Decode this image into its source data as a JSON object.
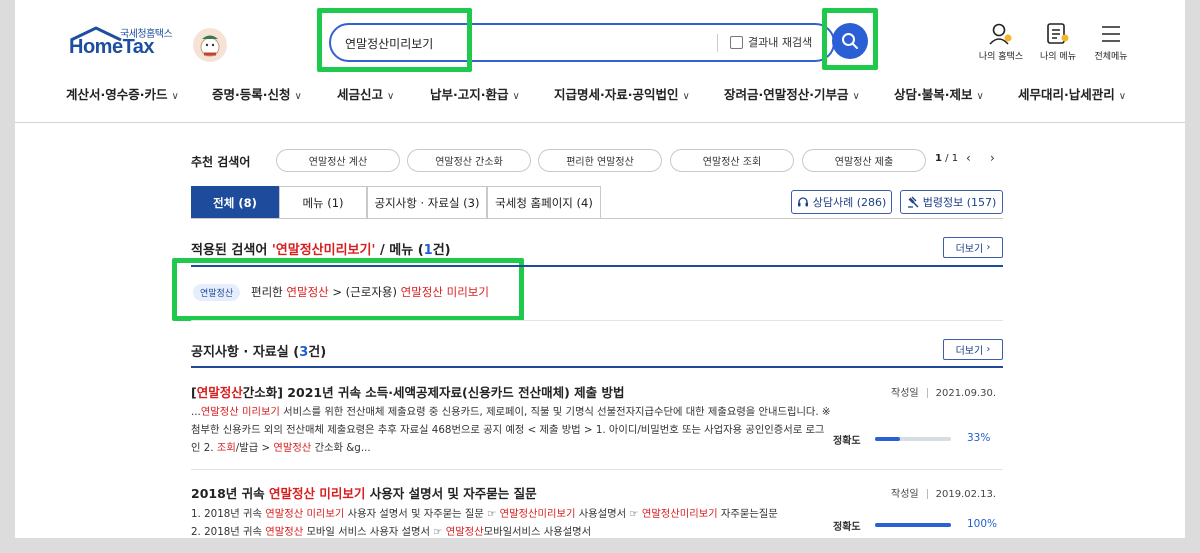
{
  "header": {
    "logo_small": "국세청홈택스",
    "logo_big": "HomeTax",
    "search_value": "연말정산미리보기",
    "refine_label": "결과내 재검색",
    "icons": [
      {
        "name": "person-icon",
        "label": "나의 홈택스"
      },
      {
        "name": "my-menu-icon",
        "label": "나의 메뉴"
      },
      {
        "name": "hamburger-icon",
        "label": "전체메뉴"
      }
    ],
    "accent": "#2a5fd6",
    "highlight": "#1ec94b"
  },
  "gnb": [
    "계산서·영수증·카드",
    "증명·등록·신청",
    "세금신고",
    "납부·고지·환급",
    "지급명세·자료·공익법인",
    "장려금·연말정산·기부금",
    "상담·불복·제보",
    "세무대리·납세관리"
  ],
  "recommended": {
    "label": "추천 검색어",
    "chips": [
      "연말정산 계산",
      "연말정산 간소화",
      "편리한 연말정산",
      "연말정산 조회",
      "연말정산 제출"
    ],
    "page_current": "1",
    "page_total": "/ 1"
  },
  "tabs": [
    {
      "label": "전체 (8)",
      "active": true
    },
    {
      "label": "메뉴 (1)",
      "active": false
    },
    {
      "label": "공지사항 · 자료실 (3)",
      "active": false
    },
    {
      "label": "국세청 홈페이지 (4)",
      "active": false
    }
  ],
  "side_buttons": [
    "상담사례 (286)",
    "법령정보 (157)"
  ],
  "menu_section": {
    "title_prefix": "적용된 검색어 ",
    "title_term": "'연말정산미리보기'",
    "title_mid": " / 메뉴 (",
    "title_count": "1",
    "title_suffix": "건)",
    "more": "더보기",
    "tag": "연말정산",
    "path_1": "편리한 ",
    "path_2": "연말정산",
    "path_3": " > (근로자용) ",
    "path_4": "연말정산 미리보기"
  },
  "notice_section": {
    "title_prefix": "공지사항 · 자료실 (",
    "title_count": "3",
    "title_suffix": "건)",
    "more": "더보기",
    "date_label": "작성일",
    "accuracy_label": "정확도"
  },
  "posts": [
    {
      "title_pre": "[",
      "title_red": "연말정산",
      "title_post": "간소화] 2021년 귀속 소득·세액공제자료(신용카드 전산매체) 제출 방법",
      "date": "2021.09.30.",
      "accuracy": 33,
      "accuracy_text": "33%",
      "b1": "...",
      "b2": "연말정산 미리보기",
      "b3": " 서비스를 위한 전산매체 제출요령 중 신용카드, 제로페이, 직불 및 기명식 선불전자지급수단에 대한 제출요령을 안내드립니다. ※ 첨부한 신용카드 외의 전산매체 제출요령은 추후 자료실 468번으로 공지 예정 < 제출 방법 > 1. 아이디/비밀번호 또는 사업자용 공인인증서로 로그인 2. ",
      "b4": "조회",
      "b5": "/발급 > ",
      "b6": "연말정산",
      "b7": " 간소화 &g..."
    },
    {
      "title_pre": "2018년 귀속 ",
      "title_red": "연말정산 미리보기",
      "title_post": " 사용자 설명서 및 자주묻는 질문",
      "date": "2019.02.13.",
      "accuracy": 100,
      "accuracy_text": "100%",
      "b1": "1. 2018년 귀속 ",
      "b2": "연말정산 미리보기",
      "b3": " 사용자 설명서 및 자주묻는 질문 ☞ ",
      "b4": "연말정산미리보기",
      "b5": " 사용설명서 ☞ ",
      "b6": "연말정산미리보기",
      "b7": " 자주묻는질문",
      "b8": "2. 2018년 귀속 ",
      "b9": "연말정산",
      "b10": " 모바일 서비스 사용자 설명서 ☞ ",
      "b11": "연말정산",
      "b12": "모바일서비스 사용설명서"
    }
  ]
}
